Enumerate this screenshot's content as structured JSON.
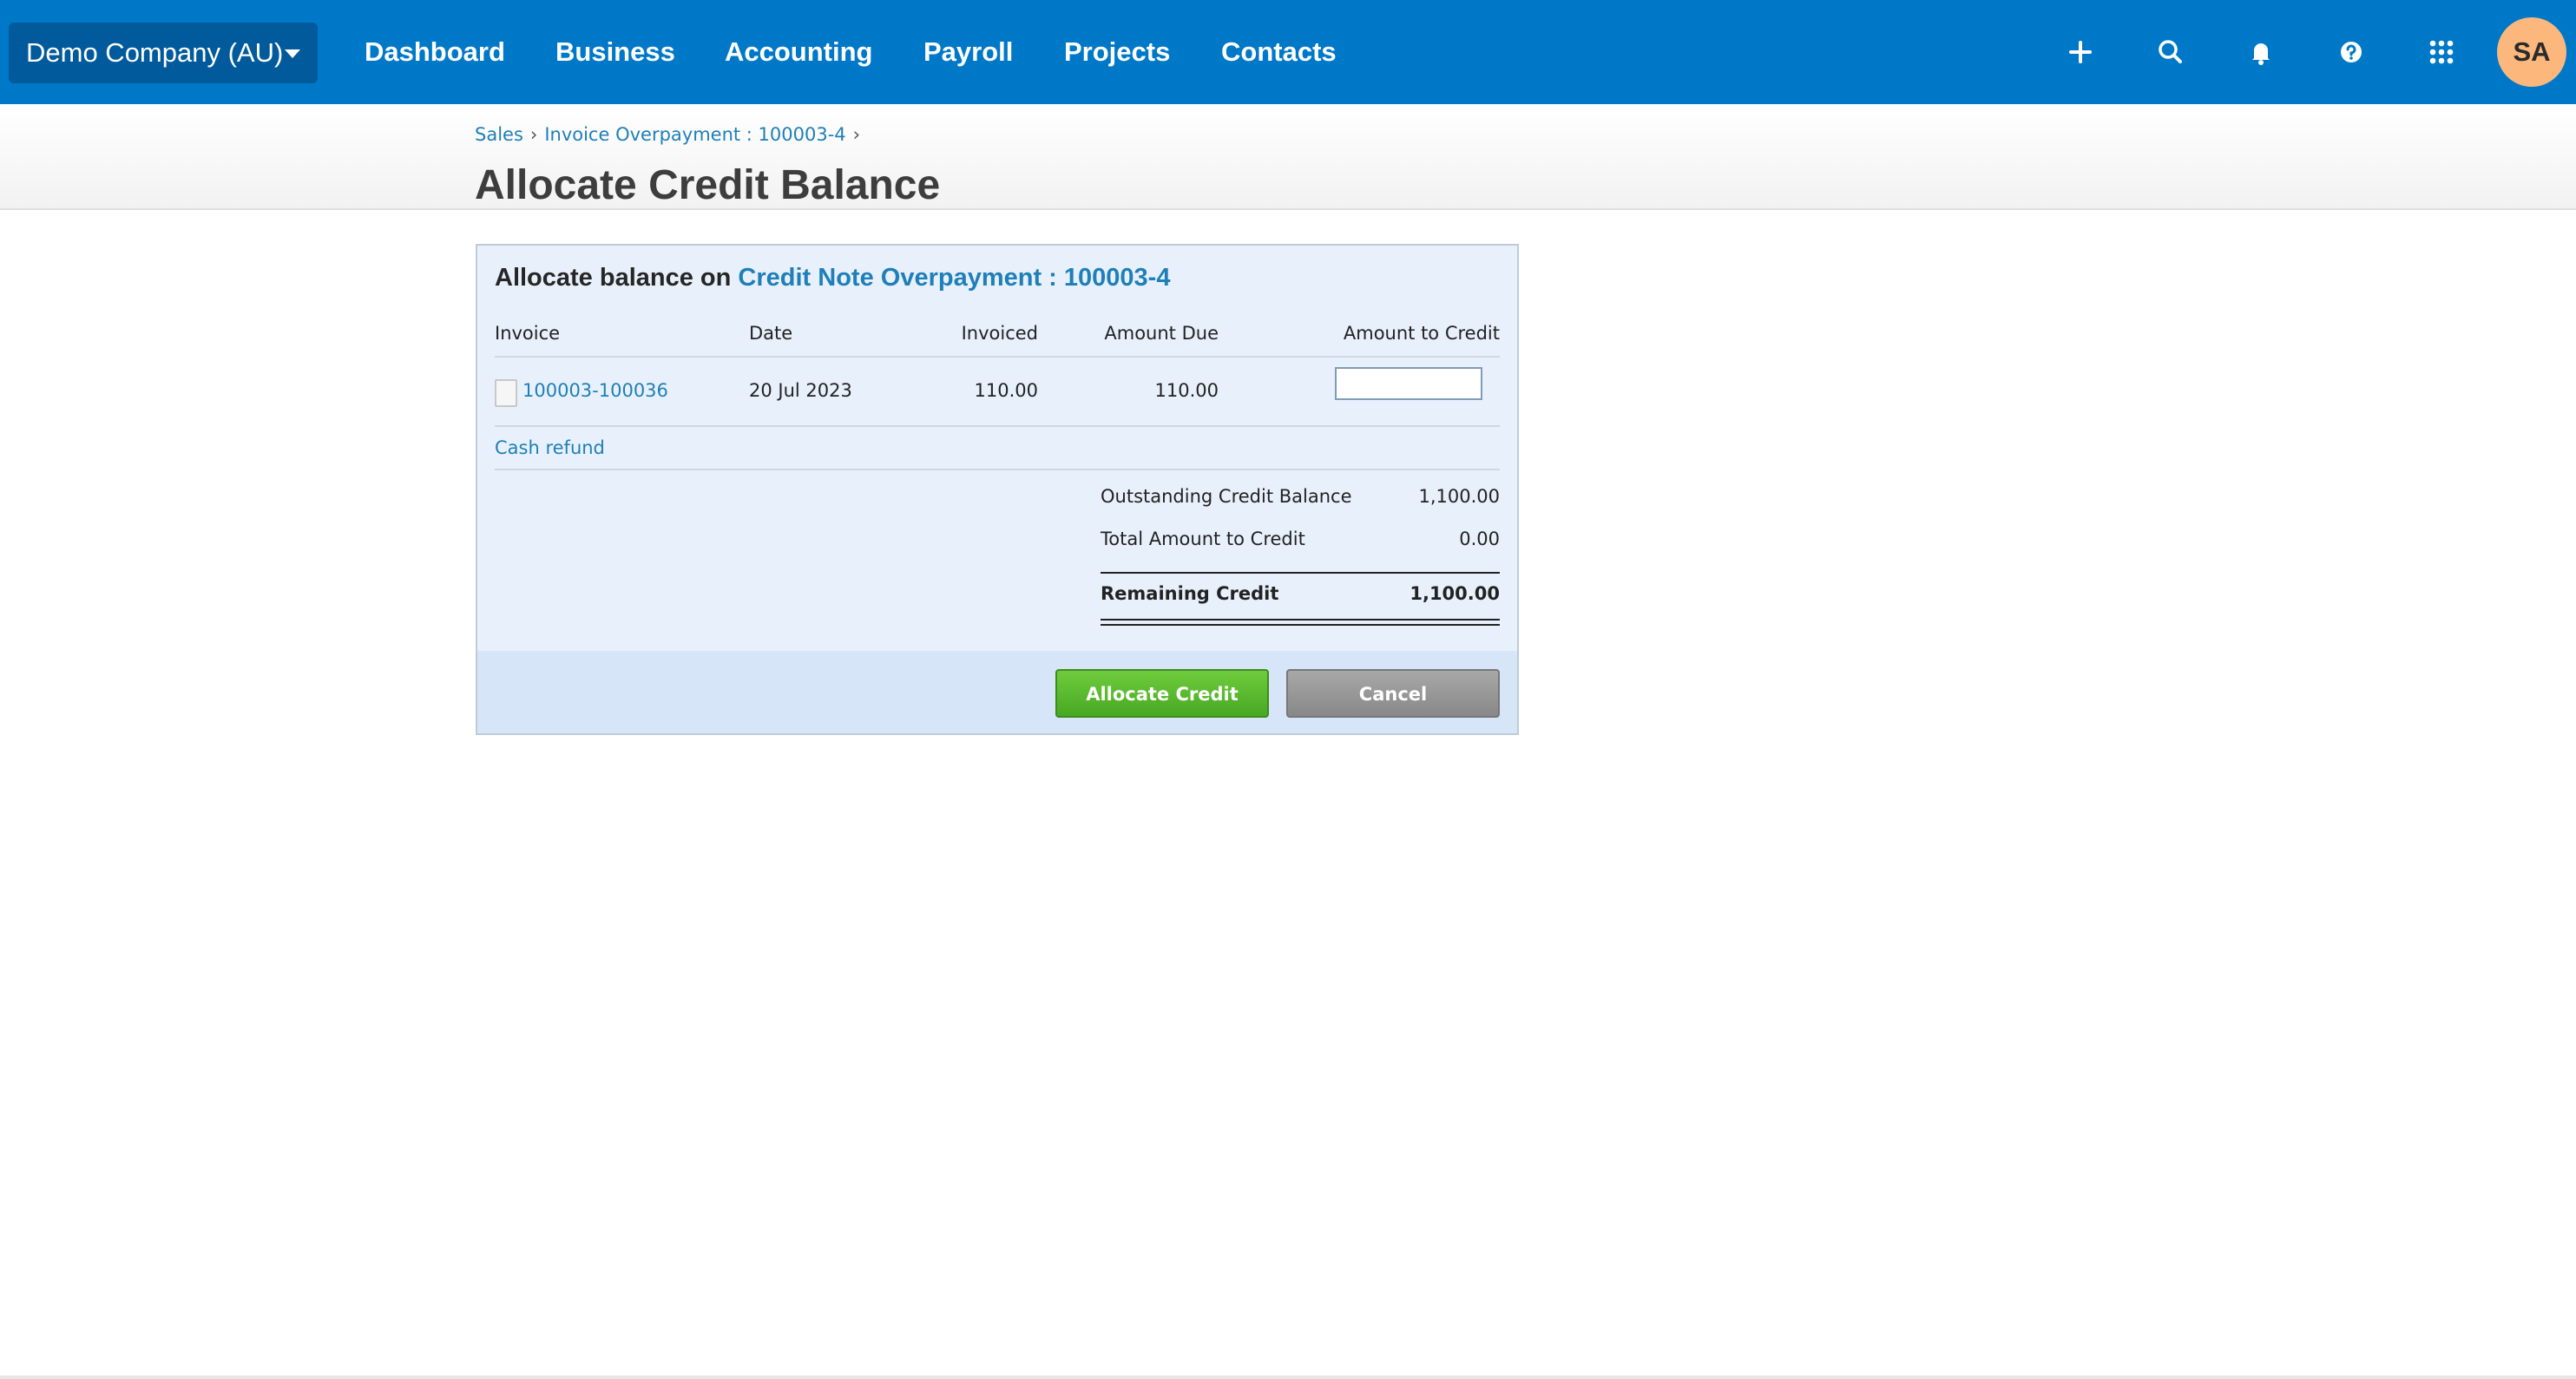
{
  "topbar": {
    "org_name": "Demo Company (AU)",
    "nav": [
      "Dashboard",
      "Business",
      "Accounting",
      "Payroll",
      "Projects",
      "Contacts"
    ],
    "icons": [
      "plus-icon",
      "search-icon",
      "bell-icon",
      "help-icon",
      "apps-grid-icon"
    ],
    "avatar_initials": "SA",
    "bar_color": "#0078c8",
    "avatar_color": "#fbb77c"
  },
  "header": {
    "breadcrumb": [
      "Sales",
      "Invoice Overpayment : 100003-4"
    ],
    "breadcrumb_separator": "›",
    "title": "Allocate Credit Balance"
  },
  "panel": {
    "heading_prefix": "Allocate balance on",
    "heading_link": "Credit Note Overpayment : 100003-4",
    "columns": [
      "Invoice",
      "Date",
      "Invoiced",
      "Amount Due",
      "Amount to Credit"
    ],
    "rows": [
      {
        "invoice": "100003-100036",
        "date": "20 Jul 2023",
        "invoiced": "110.00",
        "amount_due": "110.00",
        "amount_to_credit": ""
      }
    ],
    "cash_refund_label": "Cash refund",
    "summary": {
      "outstanding_label": "Outstanding Credit Balance",
      "outstanding_value": "1,100.00",
      "total_label": "Total Amount to Credit",
      "total_value": "0.00",
      "remaining_label": "Remaining Credit",
      "remaining_value": "1,100.00"
    },
    "buttons": {
      "allocate": "Allocate Credit",
      "cancel": "Cancel"
    }
  }
}
